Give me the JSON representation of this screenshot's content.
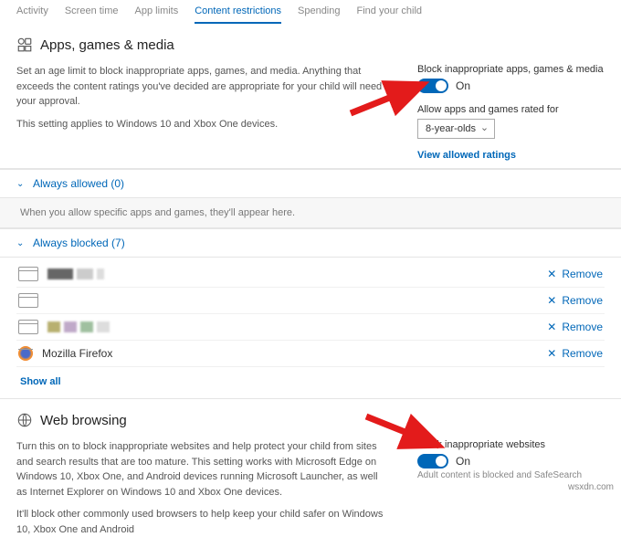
{
  "tabs": {
    "activity": "Activity",
    "screen_time": "Screen time",
    "app_limits": "App limits",
    "content_restrictions": "Content restrictions",
    "spending": "Spending",
    "find_your_child": "Find your child"
  },
  "apps_section": {
    "title": "Apps, games & media",
    "desc1": "Set an age limit to block inappropriate apps, games, and media. Anything that exceeds the content ratings you've decided are appropriate for your child will need your approval.",
    "desc2": "This setting applies to Windows 10 and Xbox One devices.",
    "block_label": "Block inappropriate apps, games & media",
    "toggle_state": "On",
    "allow_label": "Allow apps and games rated for",
    "age_select": "8-year-olds",
    "view_ratings": "View allowed ratings"
  },
  "always_allowed": {
    "label": "Always allowed (0)",
    "hint": "When you allow specific apps and games, they'll appear here."
  },
  "always_blocked": {
    "label": "Always blocked (7)",
    "remove": "Remove",
    "firefox": "Mozilla Firefox",
    "show_all": "Show all"
  },
  "web_section": {
    "title": "Web browsing",
    "desc1": "Turn this on to block inappropriate websites and help protect your child from sites and search results that are too mature. This setting works with Microsoft Edge on Windows 10, Xbox One, and Android devices running Microsoft Launcher, as well as Internet Explorer on Windows 10 and Xbox One devices.",
    "desc2": "It'll block other commonly used browsers to help keep your child safer on Windows 10, Xbox One and Android",
    "block_label": "Block inappropriate websites",
    "toggle_state": "On",
    "subtext": "Adult content is blocked and SafeSearch"
  },
  "watermark": "wsxdn.com"
}
